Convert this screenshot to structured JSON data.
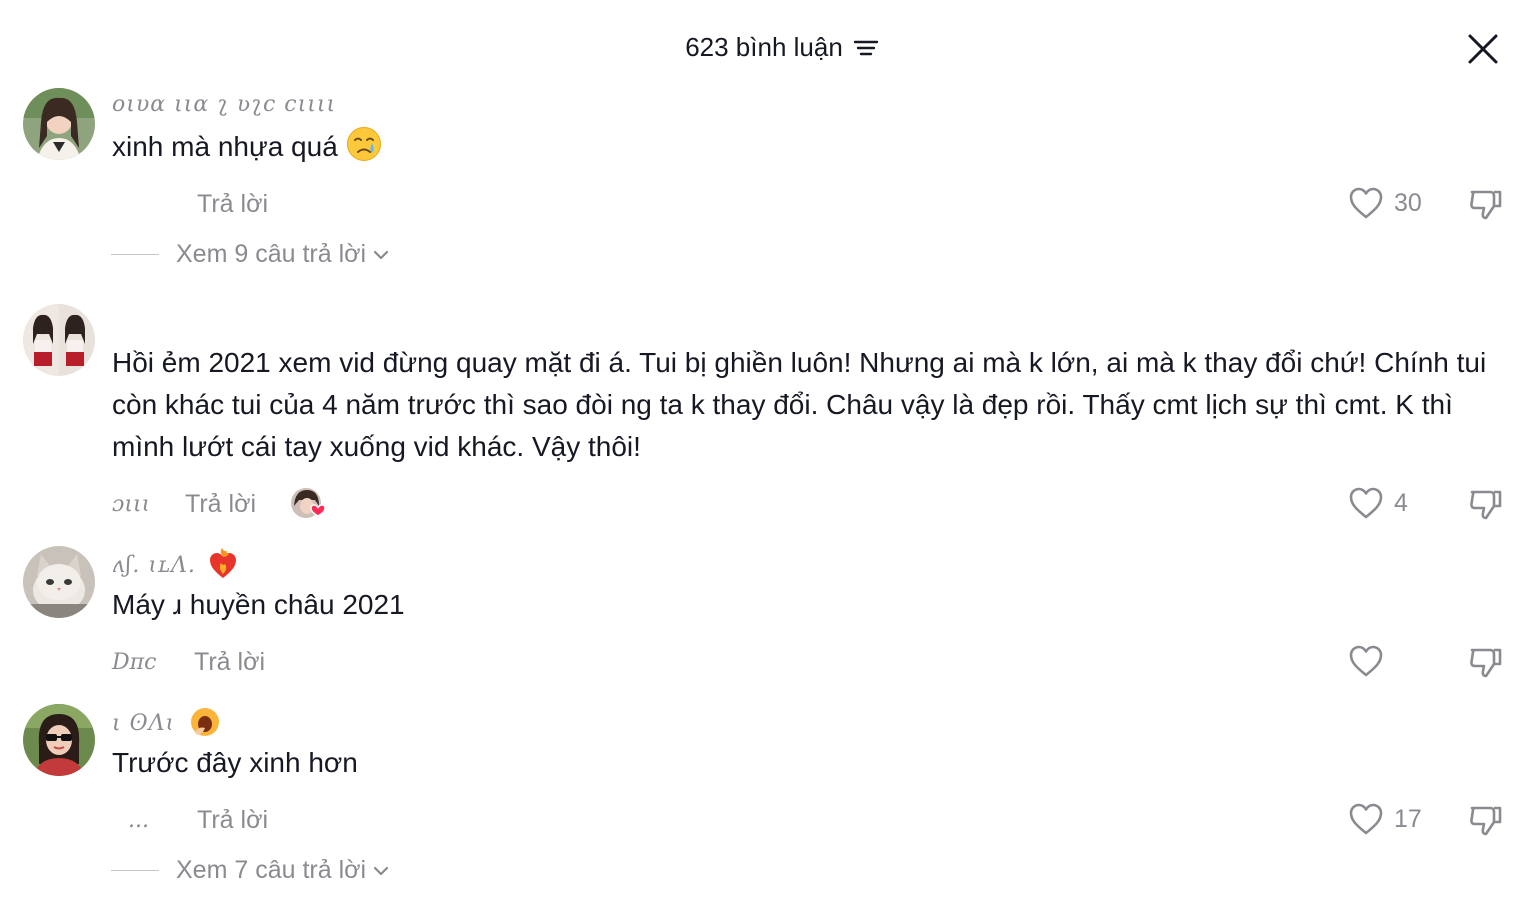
{
  "header": {
    "title": "623 bình luận"
  },
  "comments": [
    {
      "username": "oιυα ιια ʅ ʋʅc cιιιι",
      "text": "xinh mà nhựa quá",
      "date": "",
      "reply_label": "Trả lời",
      "likes": "30",
      "view_replies": "Xem 9 câu trả lời"
    },
    {
      "username": "",
      "text": "Hồi ẻm 2021 xem vid đừng quay mặt đi á. Tui bị ghiền luôn! Nhưng ai mà k lớn, ai mà k thay đổi chứ! Chính tui còn khác tui của 4 năm trước thì sao đòi ng ta k thay đổi. Châu vậy là đẹp rồi. Thấy cmt lịch sự thì cmt. K thì mình lướt cái tay xuống vid khác. Vậy thôi!",
      "date": "ɔιιɩ",
      "reply_label": "Trả lời",
      "likes": "4"
    },
    {
      "username": "ʌʃ.   ɩʟɅ.",
      "text": "Máy ɹ huyền châu 2021",
      "date": "Dπc",
      "reply_label": "Trả lời",
      "likes": ""
    },
    {
      "username": "ι   ʘɅɩ",
      "text": "Trước đây xinh hơn",
      "date": "...",
      "reply_label": "Trả lời",
      "likes": "17",
      "view_replies": "Xem 7 câu trả lời"
    }
  ],
  "colors": {
    "text": "#161823",
    "muted": "#8a8b91",
    "heart_red": "#fe2c55"
  },
  "icons": [
    "sort-icon",
    "close-icon",
    "heart-icon",
    "dislike-icon",
    "chevron-down-icon",
    "crying-emoji",
    "fire-heart-emoji",
    "yawn-emoji"
  ]
}
